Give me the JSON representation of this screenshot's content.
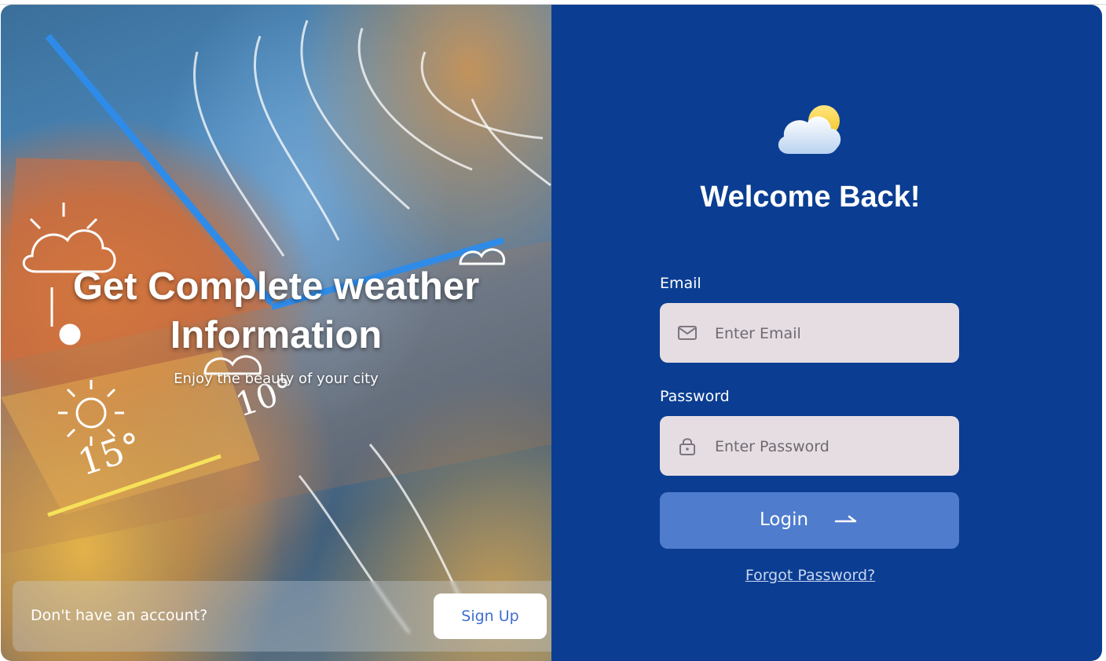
{
  "hero": {
    "title_line1": "Get Complete weather",
    "title_line2": "Information",
    "subtitle": "Enjoy the beauty of your city"
  },
  "decor": {
    "temp_1": "15°",
    "temp_2": "10°"
  },
  "signup": {
    "prompt": "Don't have an account?",
    "button_label": "Sign Up"
  },
  "login": {
    "logo_icon": "cloud-sun-icon",
    "heading": "Welcome Back!",
    "email_label": "Email",
    "email_placeholder": "Enter Email",
    "email_icon": "envelope-icon",
    "password_label": "Password",
    "password_placeholder": "Enter Password",
    "password_icon": "lock-icon",
    "submit_label": "Login",
    "submit_icon": "arrow-right-icon",
    "forgot_link": "Forgot Password?"
  },
  "colors": {
    "panel_bg": "#0b3e92",
    "input_bg": "#e6dde3",
    "button_bg": "#4f7ccd",
    "signup_text": "#3f6fd0"
  }
}
